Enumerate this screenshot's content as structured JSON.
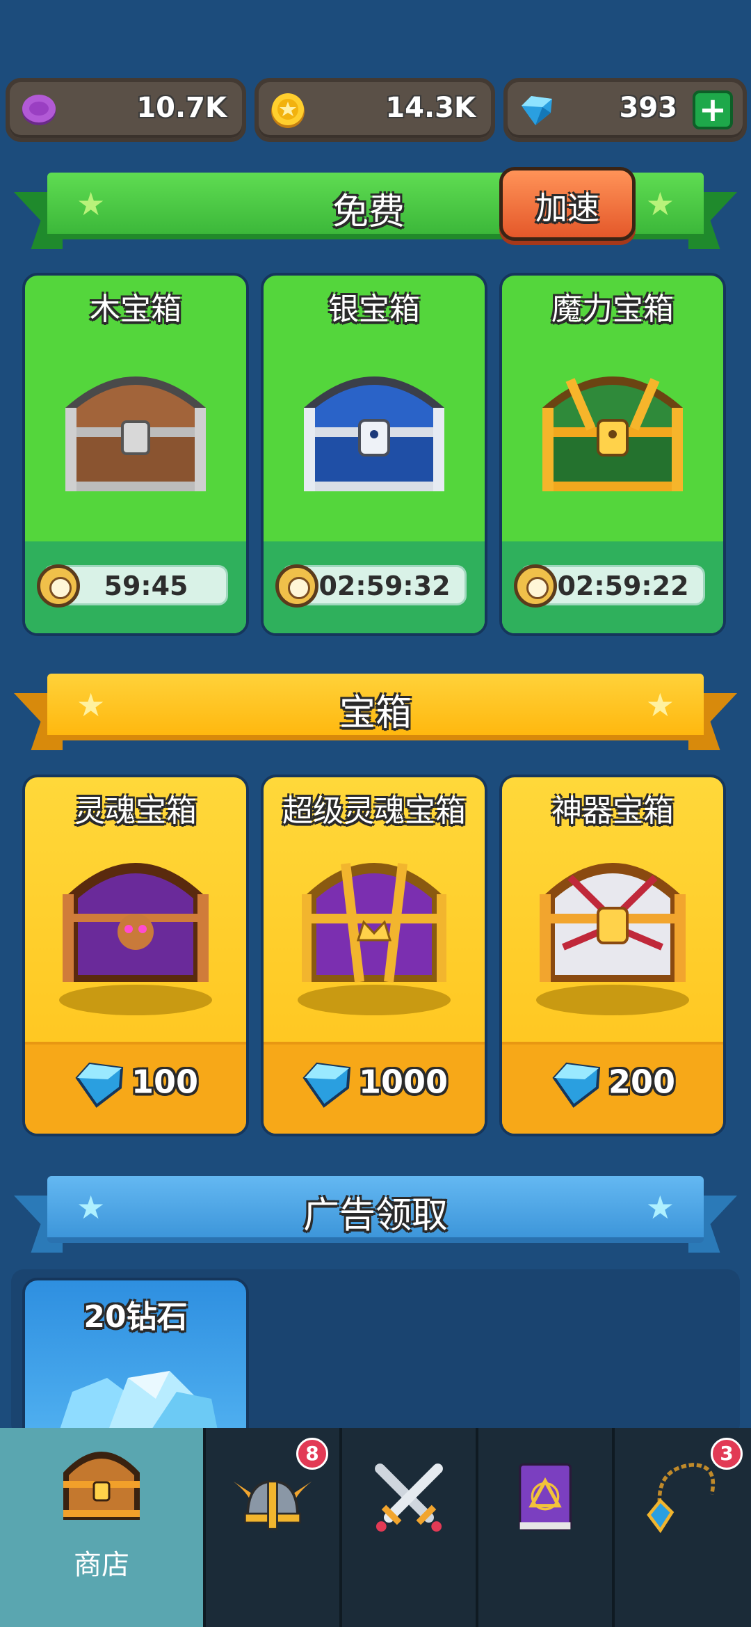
{
  "currency": {
    "purple_gem": {
      "value": "10.7K",
      "icon": "purple-gem-icon"
    },
    "gold_coin": {
      "value": "14.3K",
      "icon": "gold-coin-icon"
    },
    "diamond": {
      "value": "393",
      "icon": "diamond-icon",
      "add_label": "+"
    }
  },
  "free_section": {
    "title": "免费",
    "speedup_label": "加速",
    "chests": [
      {
        "name": "木宝箱",
        "timer": "59:45",
        "icon": "wooden-chest-icon"
      },
      {
        "name": "银宝箱",
        "timer": "02:59:32",
        "icon": "silver-chest-icon"
      },
      {
        "name": "魔力宝箱",
        "timer": "02:59:22",
        "icon": "magic-chest-icon"
      }
    ]
  },
  "chest_section": {
    "title": "宝箱",
    "chests": [
      {
        "name": "灵魂宝箱",
        "price": "100",
        "icon": "soul-chest-icon"
      },
      {
        "name": "超级灵魂宝箱",
        "price": "1000",
        "icon": "super-soul-chest-icon"
      },
      {
        "name": "神器宝箱",
        "price": "200",
        "icon": "artifact-chest-icon"
      }
    ]
  },
  "ad_section": {
    "title": "广告领取",
    "items": [
      {
        "name": "20钻石",
        "icon": "diamond-pile-icon"
      }
    ]
  },
  "nav": {
    "tabs": [
      {
        "label": "商店",
        "icon": "shop-chest-icon",
        "active": true
      },
      {
        "label": "",
        "icon": "viking-helmet-icon",
        "badge": "8"
      },
      {
        "label": "",
        "icon": "crossed-swords-icon"
      },
      {
        "label": "",
        "icon": "spellbook-icon"
      },
      {
        "label": "",
        "icon": "amulet-icon",
        "badge": "3"
      }
    ]
  },
  "colors": {
    "background": "#1c4c7c",
    "green_ribbon": "#4cc948",
    "gold_ribbon": "#ffc21f",
    "blue_ribbon": "#4aa6e8",
    "speedup_button": "#f2743a"
  }
}
